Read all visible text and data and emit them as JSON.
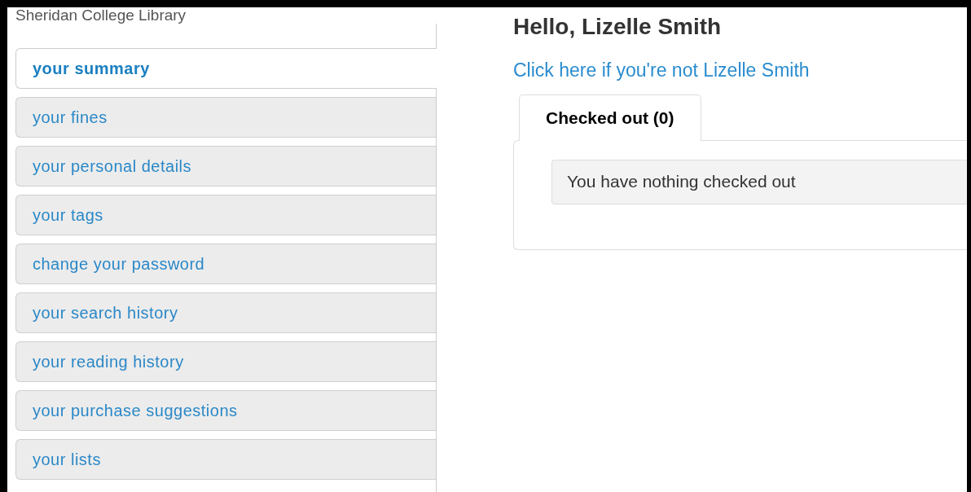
{
  "library_name": "Sheridan College Library",
  "sidebar": {
    "items": [
      {
        "label": "your summary",
        "selected": true
      },
      {
        "label": "your fines",
        "selected": false
      },
      {
        "label": "your personal details",
        "selected": false
      },
      {
        "label": "your tags",
        "selected": false
      },
      {
        "label": "change your password",
        "selected": false
      },
      {
        "label": "your search history",
        "selected": false
      },
      {
        "label": "your reading history",
        "selected": false
      },
      {
        "label": "your purchase suggestions",
        "selected": false
      },
      {
        "label": "your lists",
        "selected": false
      }
    ]
  },
  "greeting": "Hello, Lizelle Smith",
  "not_you_link": "Click here if you're not Lizelle Smith",
  "tabs": [
    {
      "label": "Checked out (0)",
      "selected": true
    }
  ],
  "message": "You have nothing checked out"
}
